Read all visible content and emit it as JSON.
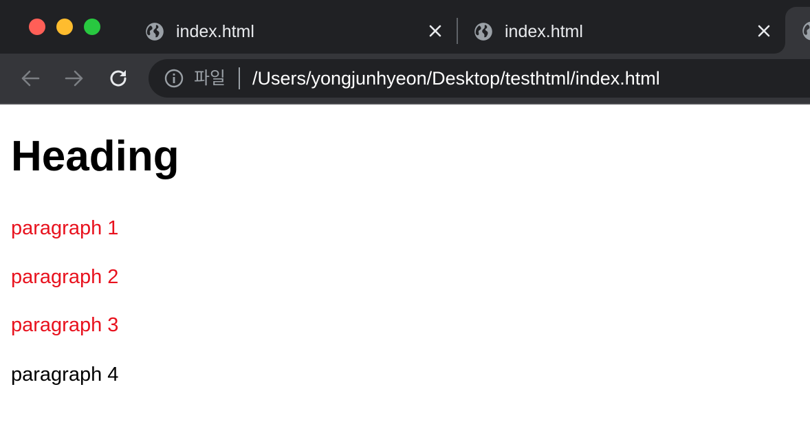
{
  "window": {
    "traffic_lights": {
      "close": "#ff5f57",
      "minimize": "#febc2e",
      "zoom": "#28c840"
    }
  },
  "tabs": [
    {
      "title": "index.html",
      "icon": "globe-icon",
      "close_icon": "close-icon"
    },
    {
      "title": "index.html",
      "icon": "globe-icon",
      "close_icon": "close-icon"
    },
    {
      "title": "",
      "icon": "globe-icon",
      "active": true
    }
  ],
  "toolbar": {
    "back_icon": "arrow-left-icon",
    "forward_icon": "arrow-right-icon",
    "reload_icon": "reload-icon"
  },
  "omnibox": {
    "info_icon": "info-icon",
    "scheme_label": "파일",
    "url": "/Users/yongjunhyeon/Desktop/testhtml/index.html"
  },
  "page": {
    "heading": "Heading",
    "paragraphs": [
      {
        "text": "paragraph 1",
        "color": "#e8111d"
      },
      {
        "text": "paragraph 2",
        "color": "#e8111d"
      },
      {
        "text": "paragraph 3",
        "color": "#e8111d"
      },
      {
        "text": "paragraph 4",
        "color": "#000000"
      }
    ]
  },
  "colors": {
    "tabstrip_bg": "#202124",
    "toolbar_bg": "#35363a",
    "omnibox_bg": "#202124",
    "page_bg": "#ffffff"
  }
}
